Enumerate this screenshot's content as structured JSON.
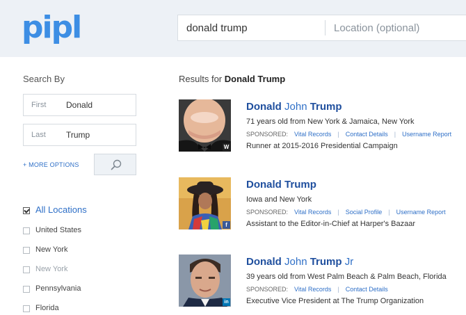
{
  "header": {
    "logo": "pipl",
    "search_name": "donald trump",
    "location_placeholder": "Location (optional)"
  },
  "sidebar": {
    "search_by_label": "Search By",
    "first_label": "First",
    "first_value": "Donald",
    "last_label": "Last",
    "last_value": "Trump",
    "more_options": "+ MORE OPTIONS",
    "locations": [
      {
        "label": "All Locations",
        "checked": true
      },
      {
        "label": "United States",
        "checked": false
      },
      {
        "label": "New York",
        "checked": false
      },
      {
        "label": "New York",
        "checked": false
      },
      {
        "label": "Pennsylvania",
        "checked": false
      },
      {
        "label": "Florida",
        "checked": false
      }
    ]
  },
  "results": {
    "prefix": "Results for ",
    "query": "Donald Trump",
    "items": [
      {
        "name_first": "Donald",
        "name_middle": " John ",
        "name_last": "Trump",
        "name_suffix": "",
        "description": "71 years old from New York & Jamaica, New York",
        "sponsored_label": "SPONSORED:",
        "links": [
          "Vital Records",
          "Contact Details",
          "Username Report"
        ],
        "job": "Runner at 2015-2016 Presidential Campaign",
        "badge": "W",
        "badge_icon": "wikipedia-icon",
        "badge_color": "#222222"
      },
      {
        "name_first": "Donald",
        "name_middle": " ",
        "name_last": "Trump",
        "name_suffix": "",
        "description": "Iowa and New York",
        "sponsored_label": "SPONSORED:",
        "links": [
          "Vital Records",
          "Social Profile",
          "Username Report"
        ],
        "job": "Assistant to the Editor-in-Chief at Harper's Bazaar",
        "badge": "f",
        "badge_icon": "facebook-icon",
        "badge_color": "#3b5998"
      },
      {
        "name_first": "Donald",
        "name_middle": " John ",
        "name_last": "Trump",
        "name_suffix": " Jr",
        "description": "39 years old from West Palm Beach & Palm Beach, Florida",
        "sponsored_label": "SPONSORED:",
        "links": [
          "Vital Records",
          "Contact Details"
        ],
        "job": "Executive Vice President at The Trump Organization",
        "badge": "in",
        "badge_icon": "linkedin-icon",
        "badge_color": "#0077b5"
      }
    ]
  },
  "colors": {
    "accent": "#2e6fc7",
    "name_bold": "#1f4f9e",
    "header_bg": "#edf1f6"
  }
}
